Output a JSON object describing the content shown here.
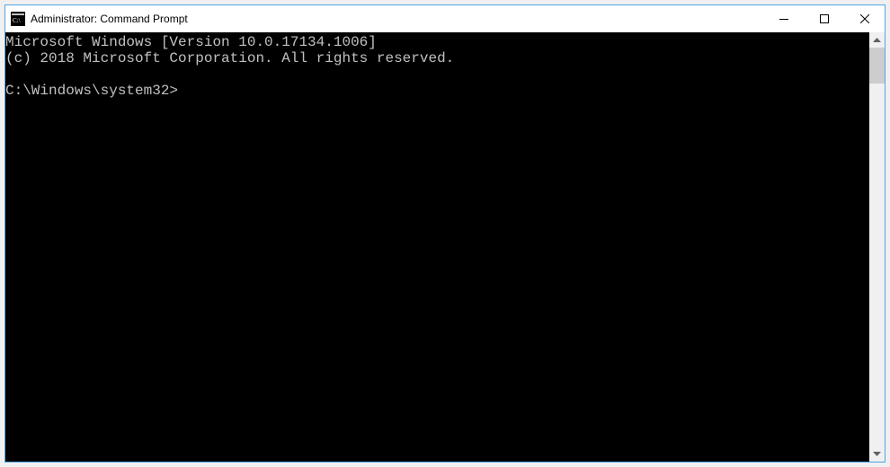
{
  "window": {
    "title": "Administrator: Command Prompt"
  },
  "console": {
    "line1": "Microsoft Windows [Version 10.0.17134.1006]",
    "line2": "(c) 2018 Microsoft Corporation. All rights reserved.",
    "blank": "",
    "prompt": "C:\\Windows\\system32>"
  }
}
